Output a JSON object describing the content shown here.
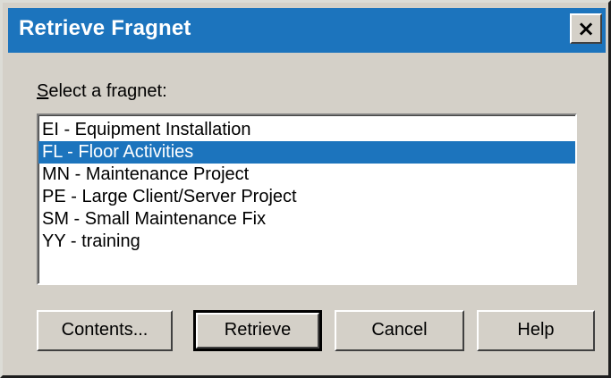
{
  "window": {
    "title": "Retrieve Fragnet",
    "close_glyph": "×"
  },
  "prompt": {
    "accel": "S",
    "rest": "elect a fragnet:"
  },
  "list": {
    "items": [
      {
        "label": "EI - Equipment Installation"
      },
      {
        "label": "FL - Floor Activities"
      },
      {
        "label": "MN - Maintenance Project"
      },
      {
        "label": "PE - Large Client/Server Project"
      },
      {
        "label": "SM - Small Maintenance Fix"
      },
      {
        "label": "YY - training"
      }
    ],
    "selected_index": 1
  },
  "buttons": {
    "contents": "Contents...",
    "retrieve": "Retrieve",
    "cancel": "Cancel",
    "help": "Help"
  },
  "colors": {
    "title_bar": "#1c74bd",
    "selection": "#1c74bd",
    "face": "#d4d0c8"
  }
}
